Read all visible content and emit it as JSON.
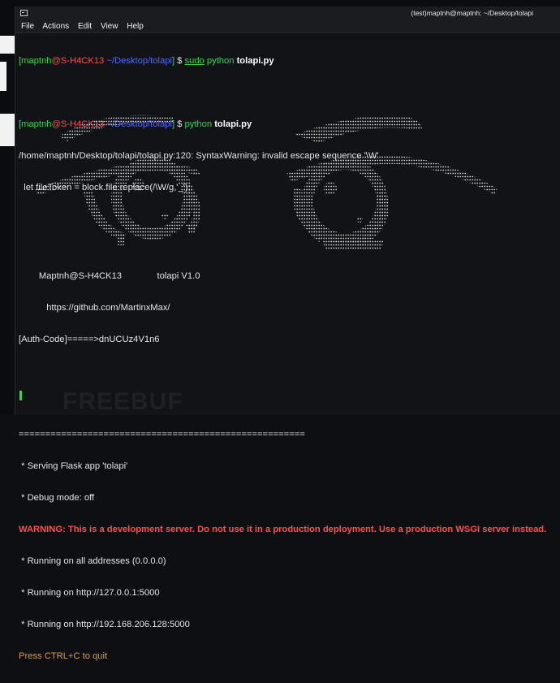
{
  "window": {
    "title": "(test)maptnh@maptnh: ~/Desktop/tolapi",
    "menu": [
      "File",
      "Actions",
      "Edit",
      "View",
      "Help"
    ]
  },
  "terminal": {
    "prompt1": {
      "bracket_open": "[",
      "user": "maptnh",
      "at": "@",
      "host": "S-H4CK13",
      "path": " ~/Desktop/tolapi",
      "bracket_close": "]",
      "dollar": " $ ",
      "cmd_sudo": "sudo",
      "cmd_python": " python",
      "cmd_file": " tolapi.py"
    },
    "prompt2": {
      "bracket_open": "[",
      "user": "maptnh",
      "at": "@",
      "host": "S-H4CK13",
      "path": " ~/Desktop/tolapi",
      "bracket_close": "]",
      "dollar": " $ ",
      "cmd_python": "python",
      "cmd_file": " tolapi.py"
    },
    "syntax_warning": "/home/maptnh/Desktop/tolapi/tolapi.py:120: SyntaxWarning: invalid escape sequence '\\W'",
    "syntax_code": "  let fileToken = block.file.replace(/\\W/g,'_');",
    "banner_author": "Maptnh@S-H4CK13",
    "banner_version": "tolapi V1.0",
    "banner_url": "https://github.com/MartinxMax/",
    "auth_code": "[Auth-Code]=====>dnUCUz4V1n6",
    "separator": "======================================================",
    "serving": " * Serving Flask app 'tolapi'",
    "debug": " * Debug mode: off",
    "warning": "WARNING: This is a development server. Do not use it in a production deployment. Use a production WSGI server instead.",
    "running_all": " * Running on all addresses (0.0.0.0)",
    "running_local": " * Running on http://127.0.0.1:5000",
    "running_ip": " * Running on http://192.168.206.128:5000",
    "quit": "Press CTRL+C to quit"
  },
  "colors": {
    "green": "#32d74b",
    "red": "#ff4b4b",
    "blue": "#4b6bff",
    "warning": "#ff4e4e",
    "orange": "#d99a3e"
  },
  "watermark": "FREEBUF"
}
